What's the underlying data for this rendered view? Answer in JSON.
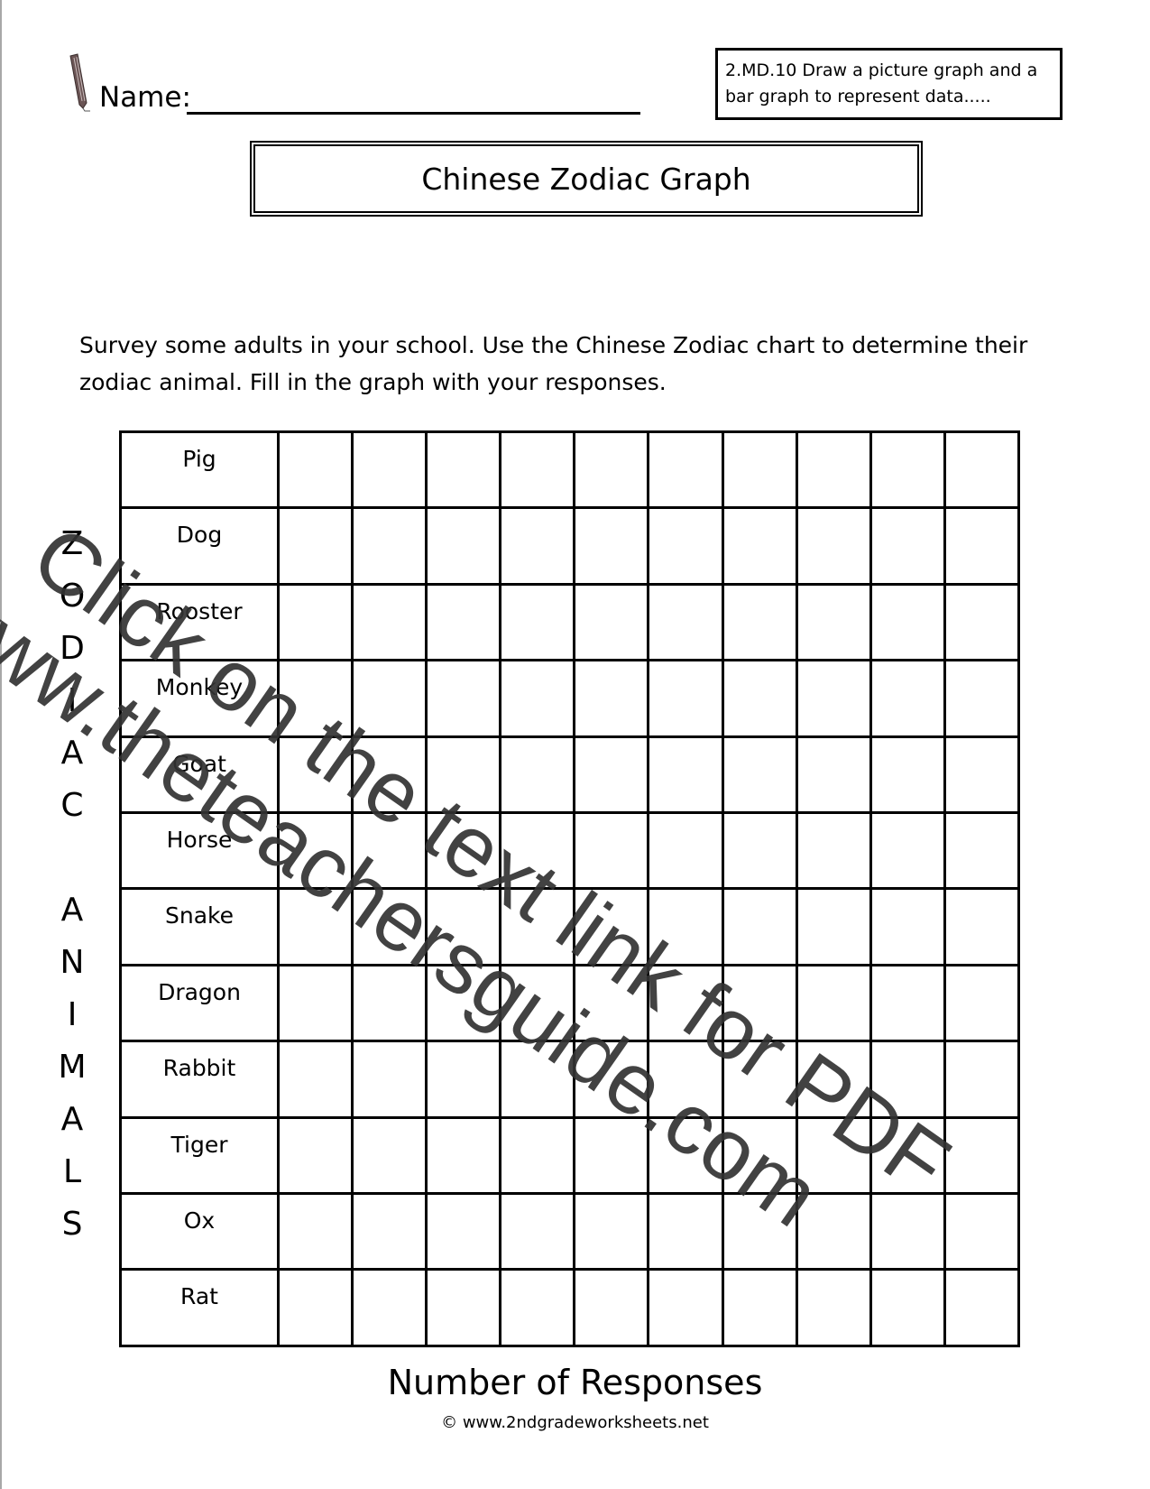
{
  "header": {
    "name_label": "Name:",
    "standard_text": "2.MD.10 Draw a picture graph and a bar graph to represent data....."
  },
  "title": "Chinese Zodiac Graph",
  "instructions": "Survey some adults in your school.  Use the Chinese Zodiac chart to determine their zodiac animal.  Fill in the graph with your responses.",
  "axis_y_letters": [
    "Z",
    "O",
    "D",
    "I",
    "A",
    "C",
    "",
    "A",
    "N",
    "I",
    "M",
    "A",
    "L",
    "S"
  ],
  "watermark": {
    "line1": "Click on the text link for PDF",
    "line2": "www.theteachersguide.com"
  },
  "chart_data": {
    "type": "table",
    "title": "Chinese Zodiac Graph",
    "ylabel": "ZODIAC ANIMALS",
    "xlabel": "Number of Responses",
    "categories": [
      "Pig",
      "Dog",
      "Rooster",
      "Monkey",
      "Goat",
      "Horse",
      "Snake",
      "Dragon",
      "Rabbit",
      "Tiger",
      "Ox",
      "Rat"
    ],
    "response_columns": 10,
    "values": [
      null,
      null,
      null,
      null,
      null,
      null,
      null,
      null,
      null,
      null,
      null,
      null
    ]
  },
  "footer": "© www.2ndgradeworksheets.net"
}
